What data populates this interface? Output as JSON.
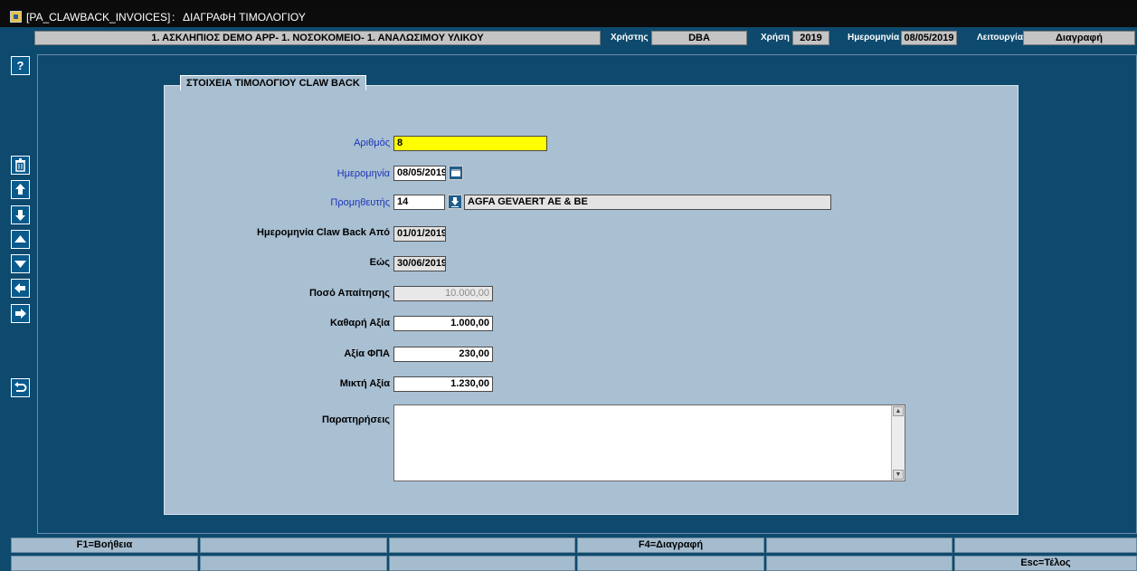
{
  "window": {
    "title": "[PA_CLAWBACK_INVOICES]",
    "separator": ":",
    "subtitle": "ΔΙΑΓΡΑΦΗ ΤΙΜΟΛΟΓΙΟΥ"
  },
  "header": {
    "context": "1. ΑΣΚΛΗΠΙΟΣ DEMO APP- 1. ΝΟΣΟΚΟΜΕΙΟ- 1. ΑΝΑΛΩΣΙΜΟΥ ΥΛΙΚΟΥ",
    "user_label": "Χρήστης",
    "user_value": "DBA",
    "year_label": "Χρήση",
    "year_value": "2019",
    "date_label": "Ημερομηνία",
    "date_value": "08/05/2019",
    "mode_label": "Λειτουργία",
    "mode_value": "Διαγραφή"
  },
  "toolbar": {
    "help": "?",
    "delete_icon": "trash-icon",
    "first_icon": "arrow-up-icon",
    "last_icon": "arrow-down-icon",
    "prev_icon": "triangle-up-icon",
    "next_icon": "triangle-down-icon",
    "left_icon": "arrow-left-icon",
    "right_icon": "arrow-right-icon",
    "back_icon": "return-icon"
  },
  "form": {
    "frame_title": "ΣΤΟΙΧΕΙΑ ΤΙΜΟΛΟΓΙΟΥ CLAW BACK",
    "number_label": "Αριθμός",
    "number_value": "8",
    "date_label": "Ημερομηνία",
    "date_value": "08/05/2019",
    "supplier_label": "Προμηθευτής",
    "supplier_code": "14",
    "supplier_name": "AGFA GEVAERT AE & BE",
    "from_label": "Ημερομηνία Claw Back Από",
    "from_value": "01/01/2019",
    "to_label": "Εώς",
    "to_value": "30/06/2019",
    "claim_label": "Ποσό Απαίτησης",
    "claim_value": "10.000,00",
    "net_label": "Καθαρή Αξία",
    "net_value": "1.000,00",
    "vat_label": "Αξία ΦΠΑ",
    "vat_value": "230,00",
    "gross_label": "Μικτή Αξία",
    "gross_value": "1.230,00",
    "notes_label": "Παρατηρήσεις",
    "notes_value": ""
  },
  "fkeys": {
    "f1": "F1=Βοήθεια",
    "f4": "F4=Διαγραφή",
    "esc": "Esc=Τέλος"
  },
  "colors": {
    "background": "#0e4a6e",
    "canvas": "#a9bfd2",
    "required_field": "#ffff00",
    "required_label": "#1a35b8"
  }
}
